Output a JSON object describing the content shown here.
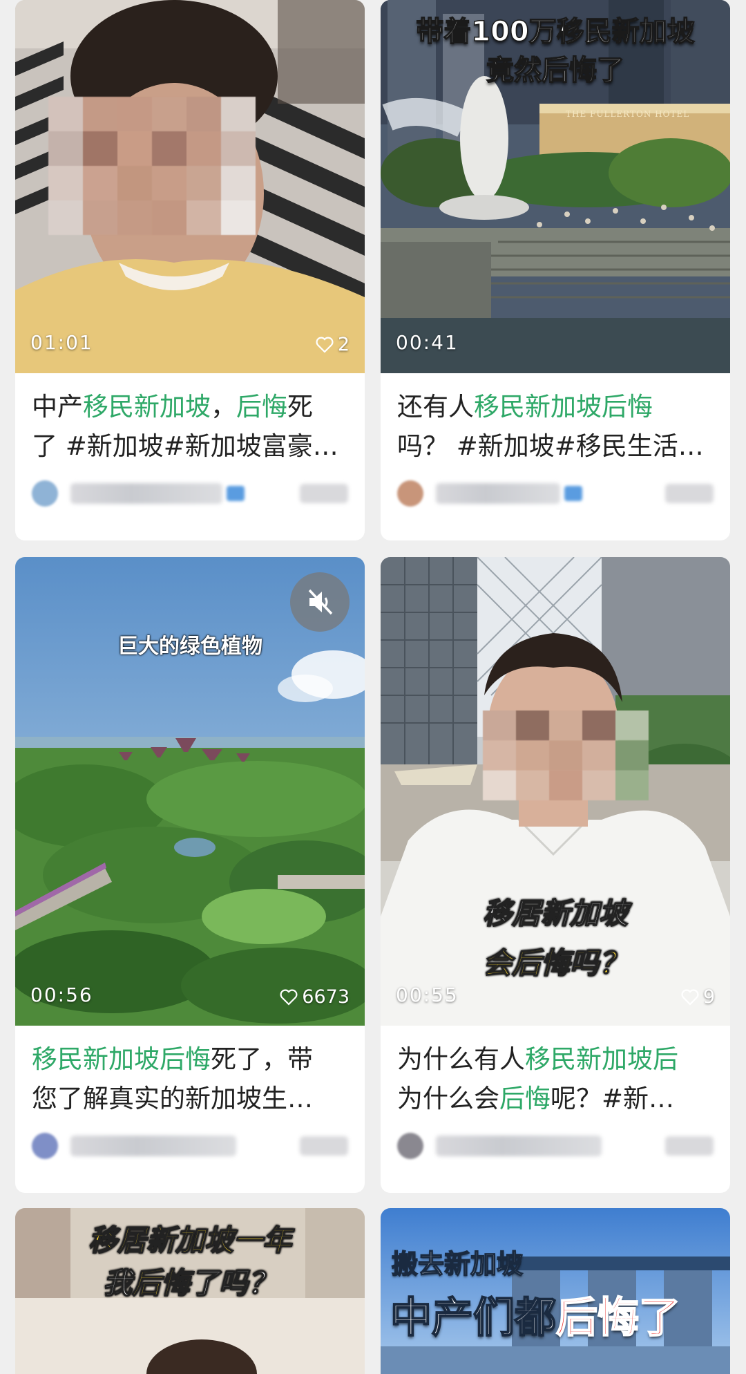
{
  "cards": [
    {
      "duration": "01:01",
      "likes": "2",
      "title_segments": [
        [
          "中产",
          "",
          "移民新加坡",
          "，",
          "后悔",
          "死"
        ],
        [
          "了 #新加坡#新加坡富豪…"
        ]
      ],
      "title_line1": {
        "a": "中产",
        "b": "移民新加坡",
        "c": "，",
        "d": "后悔",
        "e": "死"
      },
      "title_line2": "了 #新加坡#新加坡富豪…"
    },
    {
      "duration": "00:41",
      "overlay_line1": "带着100万移民新加坡",
      "overlay_line2": "竟然后悔了",
      "sign_text": "THE FULLERTON HOTEL",
      "title_line1": {
        "a": "还有人",
        "b": "移民新加坡后悔"
      },
      "title_line2": "吗？ #新加坡#移民生活…"
    },
    {
      "duration": "00:56",
      "likes": "6673",
      "overlay": "巨大的绿色植物",
      "title_line1": {
        "a": "移民新加坡后悔",
        "b": "死了，带"
      },
      "title_line2": "您了解真实的新加坡生…"
    },
    {
      "duration": "00:55",
      "likes": "9",
      "overlay_line1": "移居新加坡",
      "overlay_line2": "会后悔吗？",
      "title_line1": {
        "a": "为什么有人",
        "b": "移民新加坡后"
      },
      "title_line2": {
        "a": "为什么会",
        "b": "后悔",
        "c": "呢？#新…"
      }
    },
    {
      "overlay_line1": "移居新加坡一年",
      "overlay_line2a": "我",
      "overlay_line2b": "后悔",
      "overlay_line2c": "了吗？"
    },
    {
      "overlay_line1": "搬去新加坡",
      "overlay_line2a": "中产们都",
      "overlay_line2b": "后悔了"
    }
  ],
  "colors": {
    "highlight": "#2ea867",
    "page_bg": "#efefef",
    "card_bg": "#ffffff"
  },
  "icons": [
    "heart-icon",
    "mute-icon"
  ]
}
